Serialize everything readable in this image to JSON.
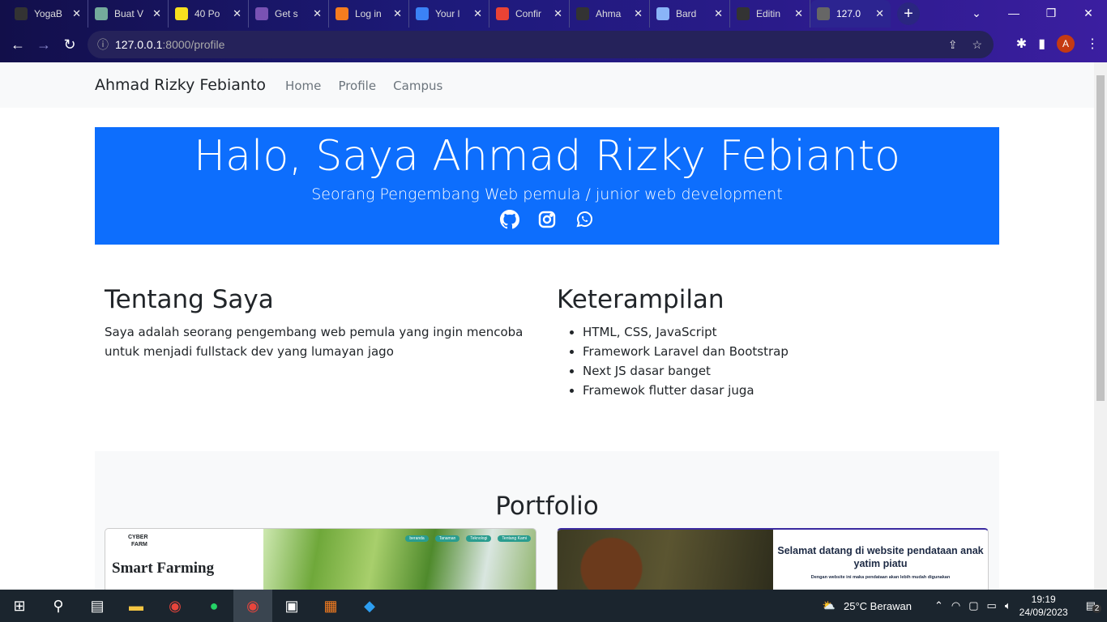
{
  "browser": {
    "tabs": [
      {
        "title": "YogaB",
        "icon": "github-icon",
        "color": "#333"
      },
      {
        "title": "Buat V",
        "icon": "chatgpt-icon",
        "color": "#74aa9c"
      },
      {
        "title": "40 Po",
        "icon": "js-icon",
        "color": "#f7df1e"
      },
      {
        "title": "Get s",
        "icon": "bootstrap-icon",
        "color": "#7952b3"
      },
      {
        "title": "Log in",
        "icon": "xampp-icon",
        "color": "#f57c1f"
      },
      {
        "title": "Your l",
        "icon": "flag-icon",
        "color": "#3b82f6"
      },
      {
        "title": "Confir",
        "icon": "gmail-icon",
        "color": "#ea4335"
      },
      {
        "title": "Ahma",
        "icon": "github-icon",
        "color": "#333"
      },
      {
        "title": "Bard",
        "icon": "bard-icon",
        "color": "#8ab4f8"
      },
      {
        "title": "Editin",
        "icon": "github-icon",
        "color": "#333"
      },
      {
        "title": "127.0",
        "icon": "globe-icon",
        "color": "#666"
      }
    ],
    "url_host": "127.0.0.1",
    "url_rest": ":8000/profile",
    "profile_initial": "A"
  },
  "navbar": {
    "brand": "Ahmad Rizky Febianto",
    "links": [
      "Home",
      "Profile",
      "Campus"
    ]
  },
  "hero": {
    "title": "Halo, Saya Ahmad Rizky Febianto",
    "subtitle": "Seorang Pengembang Web pemula / junior web development",
    "bg": "#0d6efd"
  },
  "about": {
    "title": "Tentang Saya",
    "text": "Saya adalah seorang pengembang web pemula yang ingin mencoba untuk menjadi fullstack dev yang lumayan jago"
  },
  "skills": {
    "title": "Keterampilan",
    "items": [
      "HTML, CSS, JavaScript",
      "Framework Laravel dan Bootstrap",
      "Next JS dasar banget",
      "Framewok flutter dasar juga"
    ]
  },
  "portfolio": {
    "title": "Portfolio",
    "card1": {
      "logo_line1": "CYBER",
      "logo_line2": "FARM",
      "heading": "Smart Farming",
      "nav": [
        "beranda",
        "Tanaman",
        "Teknologi",
        "Tentang Kami"
      ]
    },
    "card2": {
      "heading": "Selamat datang di website pendataan anak yatim piatu",
      "sub": "Dengan website ini maka pendataan akan lebih mudah digunakan"
    }
  },
  "taskbar": {
    "weather": "25°C  Berawan",
    "time": "19:19",
    "date": "24/09/2023",
    "notifications": "2"
  }
}
